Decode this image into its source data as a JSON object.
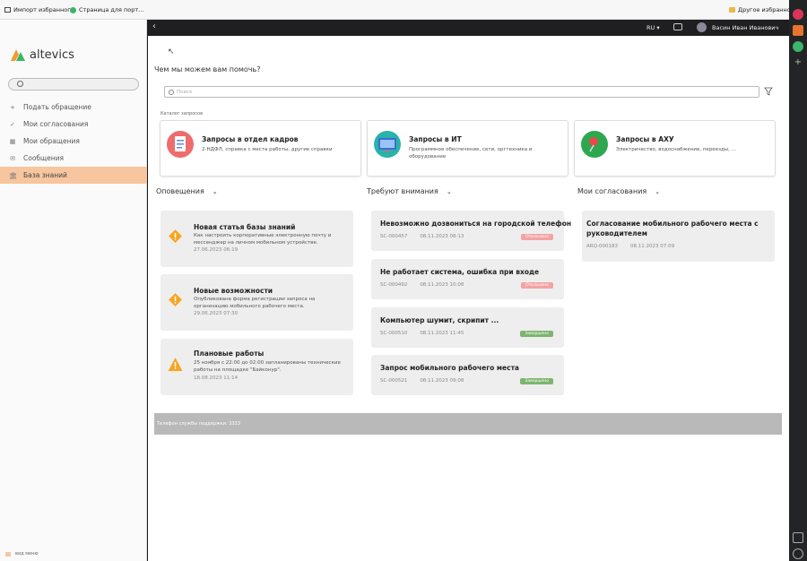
{
  "bookmarks": {
    "item1": "Импорт избранного",
    "item2": "Страница для порт...",
    "other": "Другое избранное"
  },
  "sidebar": {
    "logo": "altevics",
    "items": [
      {
        "icon": "+",
        "label": "Подать обращение"
      },
      {
        "icon": "✓",
        "label": "Мои согласования"
      },
      {
        "icon": "▦",
        "label": "Мои обращения"
      },
      {
        "icon": "✉",
        "label": "Сообщения"
      },
      {
        "icon": "🏛",
        "label": "База знаний"
      }
    ],
    "footer": "вид меню"
  },
  "topbar": {
    "back": "‹",
    "lang": "RU ▾",
    "user": "Васин Иван Иванович"
  },
  "main": {
    "question": "Чем мы можем вам помочь?",
    "search_placeholder": "Поиск",
    "catalog_label": "Каталог запросов",
    "catalog": [
      {
        "title": "Запросы в отдел кадров",
        "desc": "2-НДФЛ, справка с места работы, другие справки"
      },
      {
        "title": "Запросы в ИТ",
        "desc": "Программное обеспечение, сети, оргтехника и оборудование"
      },
      {
        "title": "Запросы в АХУ",
        "desc": "Электричество, водоснабжение, переезды, ..."
      }
    ],
    "columns": {
      "alerts": "Оповещения",
      "attention": "Требуют внимания",
      "approvals": "Мои согласования"
    },
    "alerts": [
      {
        "title": "Новая статья базы знаний",
        "text": "Как настроить корпоративные электронную почту и мессенджер на личном мобильном устройстве.",
        "date": "27.06.2023 06:19"
      },
      {
        "title": "Новые возможности",
        "text": "Опубликована форма регистрации запроса на организацию мобильного рабочего места.",
        "date": "29.06.2023 07:30"
      },
      {
        "title": "Плановые работы",
        "text": "25 ноября с 22:00 до 02:00 запланированы технические работы на площадке \"Байконур\".",
        "date": "18.08.2023 11:14"
      }
    ],
    "attention": [
      {
        "title": "Невозможно дозвониться на городской телефон",
        "id": "SC-000457",
        "date": "08.11.2023 08:13",
        "status": "Отклонено"
      },
      {
        "title": "Не работает система, ошибка при входе",
        "id": "SC-000492",
        "date": "08.11.2023 10:08",
        "status": "Отклонено"
      },
      {
        "title": "Компьютер шумит, скрипит ...",
        "id": "SC-000510",
        "date": "08.11.2023 11:45",
        "status": "Завершено"
      },
      {
        "title": "Запрос мобильного рабочего места",
        "id": "SC-000521",
        "date": "08.11.2023 09:08",
        "status": "Завершено"
      }
    ],
    "approvals": [
      {
        "title": "Согласование мобильного рабочего места с руководителем",
        "id": "ARQ-000183",
        "date": "08.11.2023 07:09"
      }
    ],
    "footer": "Телефон службы поддержки: 3333"
  },
  "colors": {
    "accent": "#f7c59e",
    "rejected": "#f4a3a3",
    "done": "#7cb56e"
  }
}
